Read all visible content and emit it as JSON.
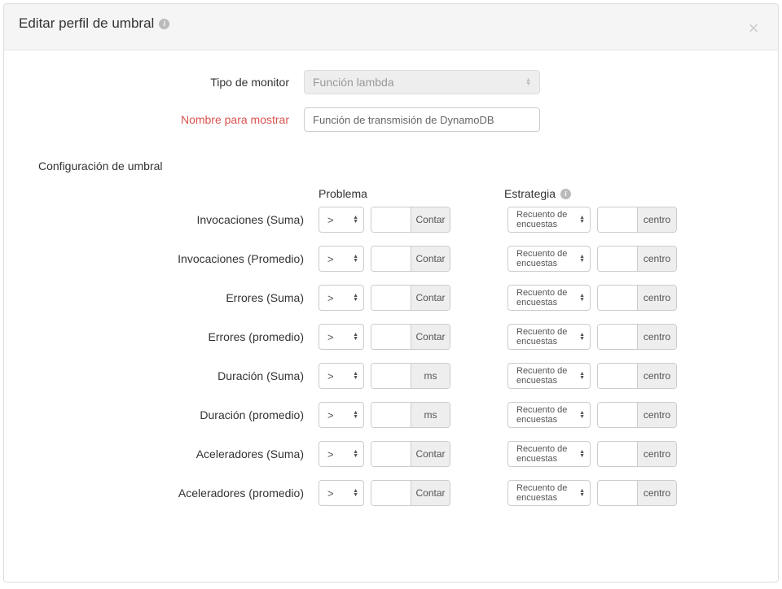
{
  "header": {
    "title": "Editar perfil de umbral"
  },
  "form": {
    "monitor_type_label": "Tipo de monitor",
    "monitor_type_value": "Función lambda",
    "display_name_label": "Nombre para mostrar",
    "display_name_value": "Función de transmisión de DynamoDB"
  },
  "threshold_section_title": "Configuración de umbral",
  "columns": {
    "problem": "Problema",
    "strategy": "Estrategia"
  },
  "rows": [
    {
      "label": "Invocaciones (Suma)",
      "op": ">",
      "unit": "Contar",
      "strategy": "Recuento de encuestas",
      "unit2": "centro"
    },
    {
      "label": "Invocaciones (Promedio)",
      "op": ">",
      "unit": "Contar",
      "strategy": "Recuento de encuestas",
      "unit2": "centro"
    },
    {
      "label": "Errores (Suma)",
      "op": ">",
      "unit": "Contar",
      "strategy": "Recuento de encuestas",
      "unit2": "centro"
    },
    {
      "label": "Errores (promedio)",
      "op": ">",
      "unit": "Contar",
      "strategy": "Recuento de encuestas",
      "unit2": "centro"
    },
    {
      "label": "Duración (Suma)",
      "op": ">",
      "unit": "ms",
      "strategy": "Recuento de encuestas",
      "unit2": "centro"
    },
    {
      "label": "Duración (promedio)",
      "op": ">",
      "unit": "ms",
      "strategy": "Recuento de encuestas",
      "unit2": "centro"
    },
    {
      "label": "Aceleradores (Suma)",
      "op": ">",
      "unit": "Contar",
      "strategy": "Recuento de encuestas",
      "unit2": "centro"
    },
    {
      "label": "Aceleradores (promedio)",
      "op": ">",
      "unit": "Contar",
      "strategy": "Recuento de encuestas",
      "unit2": "centro"
    }
  ]
}
